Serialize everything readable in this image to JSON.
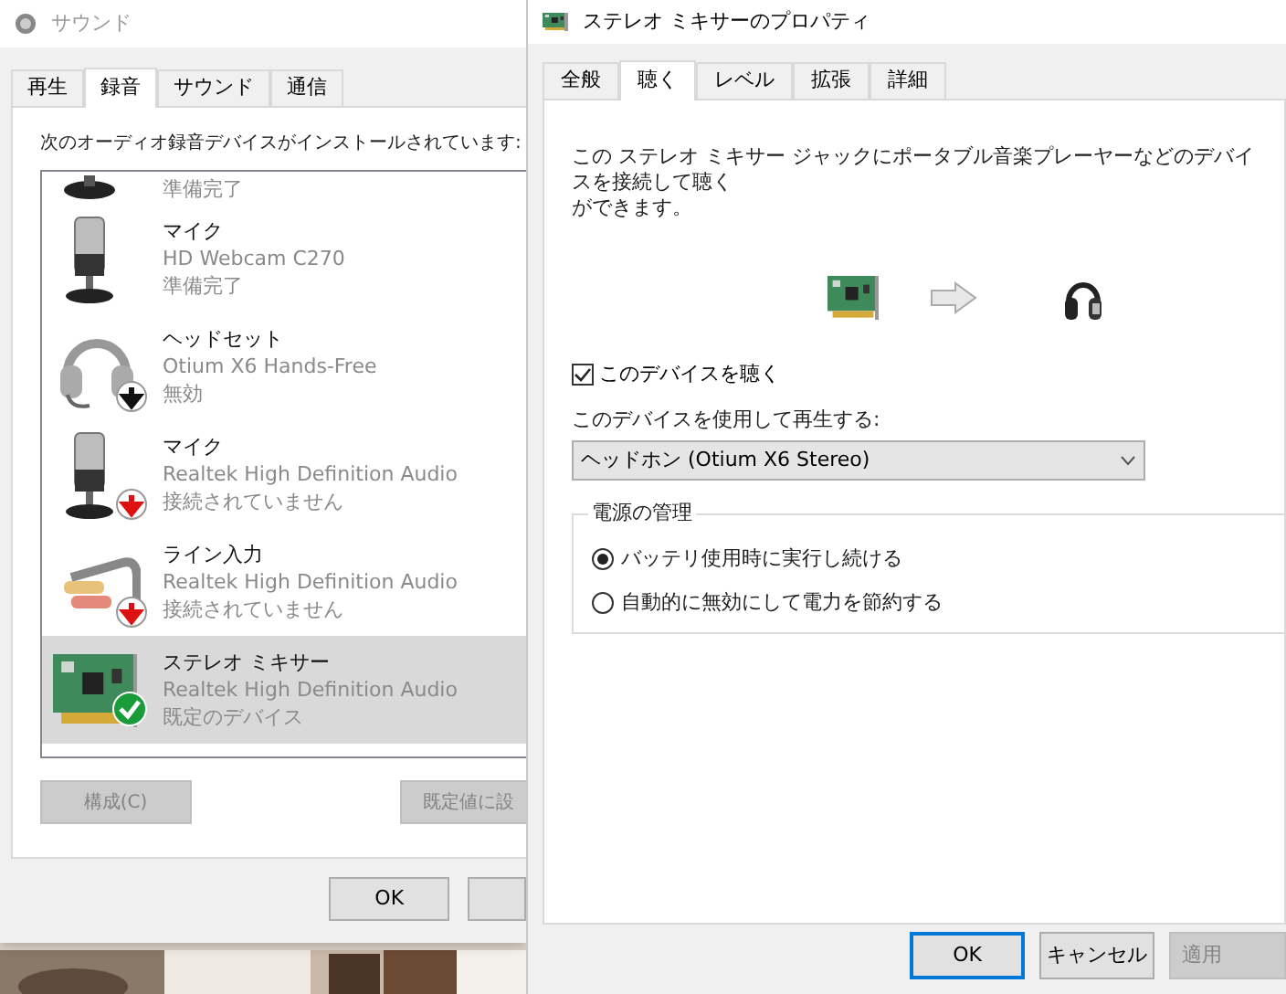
{
  "sound_window": {
    "title": "サウンド",
    "tabs": [
      {
        "label": "再生",
        "selected": false
      },
      {
        "label": "録音",
        "selected": true
      },
      {
        "label": "サウンド",
        "selected": false
      },
      {
        "label": "通信",
        "selected": false
      }
    ],
    "instruction": "次のオーディオ録音デバイスがインストールされています:",
    "devices": [
      {
        "kind": "partial",
        "status": "準備完了",
        "selected": false
      },
      {
        "kind": "mic",
        "name": "マイク",
        "device": "HD Webcam C270",
        "status": "準備完了",
        "selected": false,
        "disabled": false,
        "connected": true,
        "default": false
      },
      {
        "kind": "headset",
        "name": "ヘッドセット",
        "device": "Otium X6 Hands-Free",
        "status": "無効",
        "selected": false,
        "disabled": true,
        "connected": true,
        "default": false
      },
      {
        "kind": "mic",
        "name": "マイク",
        "device": "Realtek High Definition Audio",
        "status": "接続されていません",
        "selected": false,
        "disabled": false,
        "connected": false,
        "default": false
      },
      {
        "kind": "line-in",
        "name": "ライン入力",
        "device": "Realtek High Definition Audio",
        "status": "接続されていません",
        "selected": false,
        "disabled": false,
        "connected": false,
        "default": false
      },
      {
        "kind": "card",
        "name": "ステレオ ミキサー",
        "device": "Realtek High Definition Audio",
        "status": "既定のデバイス",
        "selected": true,
        "disabled": false,
        "connected": true,
        "default": true
      }
    ],
    "buttons": [
      {
        "label": "構成(C)",
        "disabled": true
      },
      {
        "label": "既定値に設",
        "disabled": true
      }
    ],
    "ok_button": "OK"
  },
  "properties_window": {
    "title": "ステレオ ミキサーのプロパティ",
    "tabs": [
      {
        "label": "全般",
        "selected": false
      },
      {
        "label": "聴く",
        "selected": true
      },
      {
        "label": "レベル",
        "selected": false
      },
      {
        "label": "拡張",
        "selected": false
      },
      {
        "label": "詳細",
        "selected": false
      }
    ],
    "description": [
      "この ステレオ ミキサー ジャックにポータブル音楽プレーヤーなどのデバイスを接続して聴く",
      "ができます。"
    ],
    "listen_checkbox": {
      "label": "このデバイスを聴く",
      "checked": true
    },
    "playback_label": "このデバイスを使用して再生する:",
    "playback_dropdown": {
      "value": "ヘッドホン (Otium X6 Stereo)"
    },
    "power_group": {
      "title": "電源の管理",
      "options": [
        {
          "label": "バッテリ使用時に実行し続ける",
          "selected": true
        },
        {
          "label": "自動的に無効にして電力を節約する",
          "selected": false
        }
      ]
    },
    "buttons": [
      {
        "label": "OK",
        "default": true,
        "disabled": false
      },
      {
        "label": "キャンセル",
        "default": false,
        "disabled": false
      },
      {
        "label": "適用",
        "default": false,
        "disabled": true
      }
    ]
  }
}
